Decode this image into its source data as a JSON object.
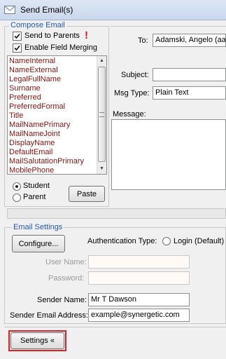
{
  "window": {
    "title": "Send Email(s)"
  },
  "compose": {
    "group_label": "Compose Email",
    "send_to_parents": {
      "label": "Send to Parents",
      "checked": true
    },
    "enable_field_merging": {
      "label": "Enable Field Merging",
      "checked": true
    },
    "merge_fields": [
      "NameInternal",
      "NameExternal",
      "LegalFullName",
      "Surname",
      "Preferred",
      "PreferredFormal",
      "Title",
      "MailNamePrimary",
      "MailNameJoint",
      "DisplayName",
      "DefaultEmail",
      "MailSalutationPrimary",
      "MobilePhone"
    ],
    "student_label": "Student",
    "parent_label": "Parent",
    "selected_recipient": "Student",
    "paste_label": "Paste",
    "to_label": "To:",
    "to_value": "Adamski, Angelo  (aa",
    "subject_label": "Subject:",
    "subject_value": "",
    "msg_type_label": "Msg Type:",
    "msg_type_value": "Plain Text",
    "message_label": "Message:"
  },
  "email_settings": {
    "group_label": "Email Settings",
    "configure_label": "Configure...",
    "auth_type_label": "Authentication Type:",
    "auth_option_label": "Login (Default)",
    "user_name_label": "User Name:",
    "user_name_value": "",
    "password_label": "Password:",
    "password_value": "",
    "sender_name_label": "Sender Name:",
    "sender_name_value": "Mr T Dawson",
    "sender_email_label": "Sender Email Address:",
    "sender_email_value": "example@synergetic.com"
  },
  "footer": {
    "settings_label": "Settings «"
  },
  "colors": {
    "highlight": "#e02020",
    "group_label": "#1e5bb8",
    "merge_field_text": "#8b1010",
    "required_mark": "#e01010"
  }
}
